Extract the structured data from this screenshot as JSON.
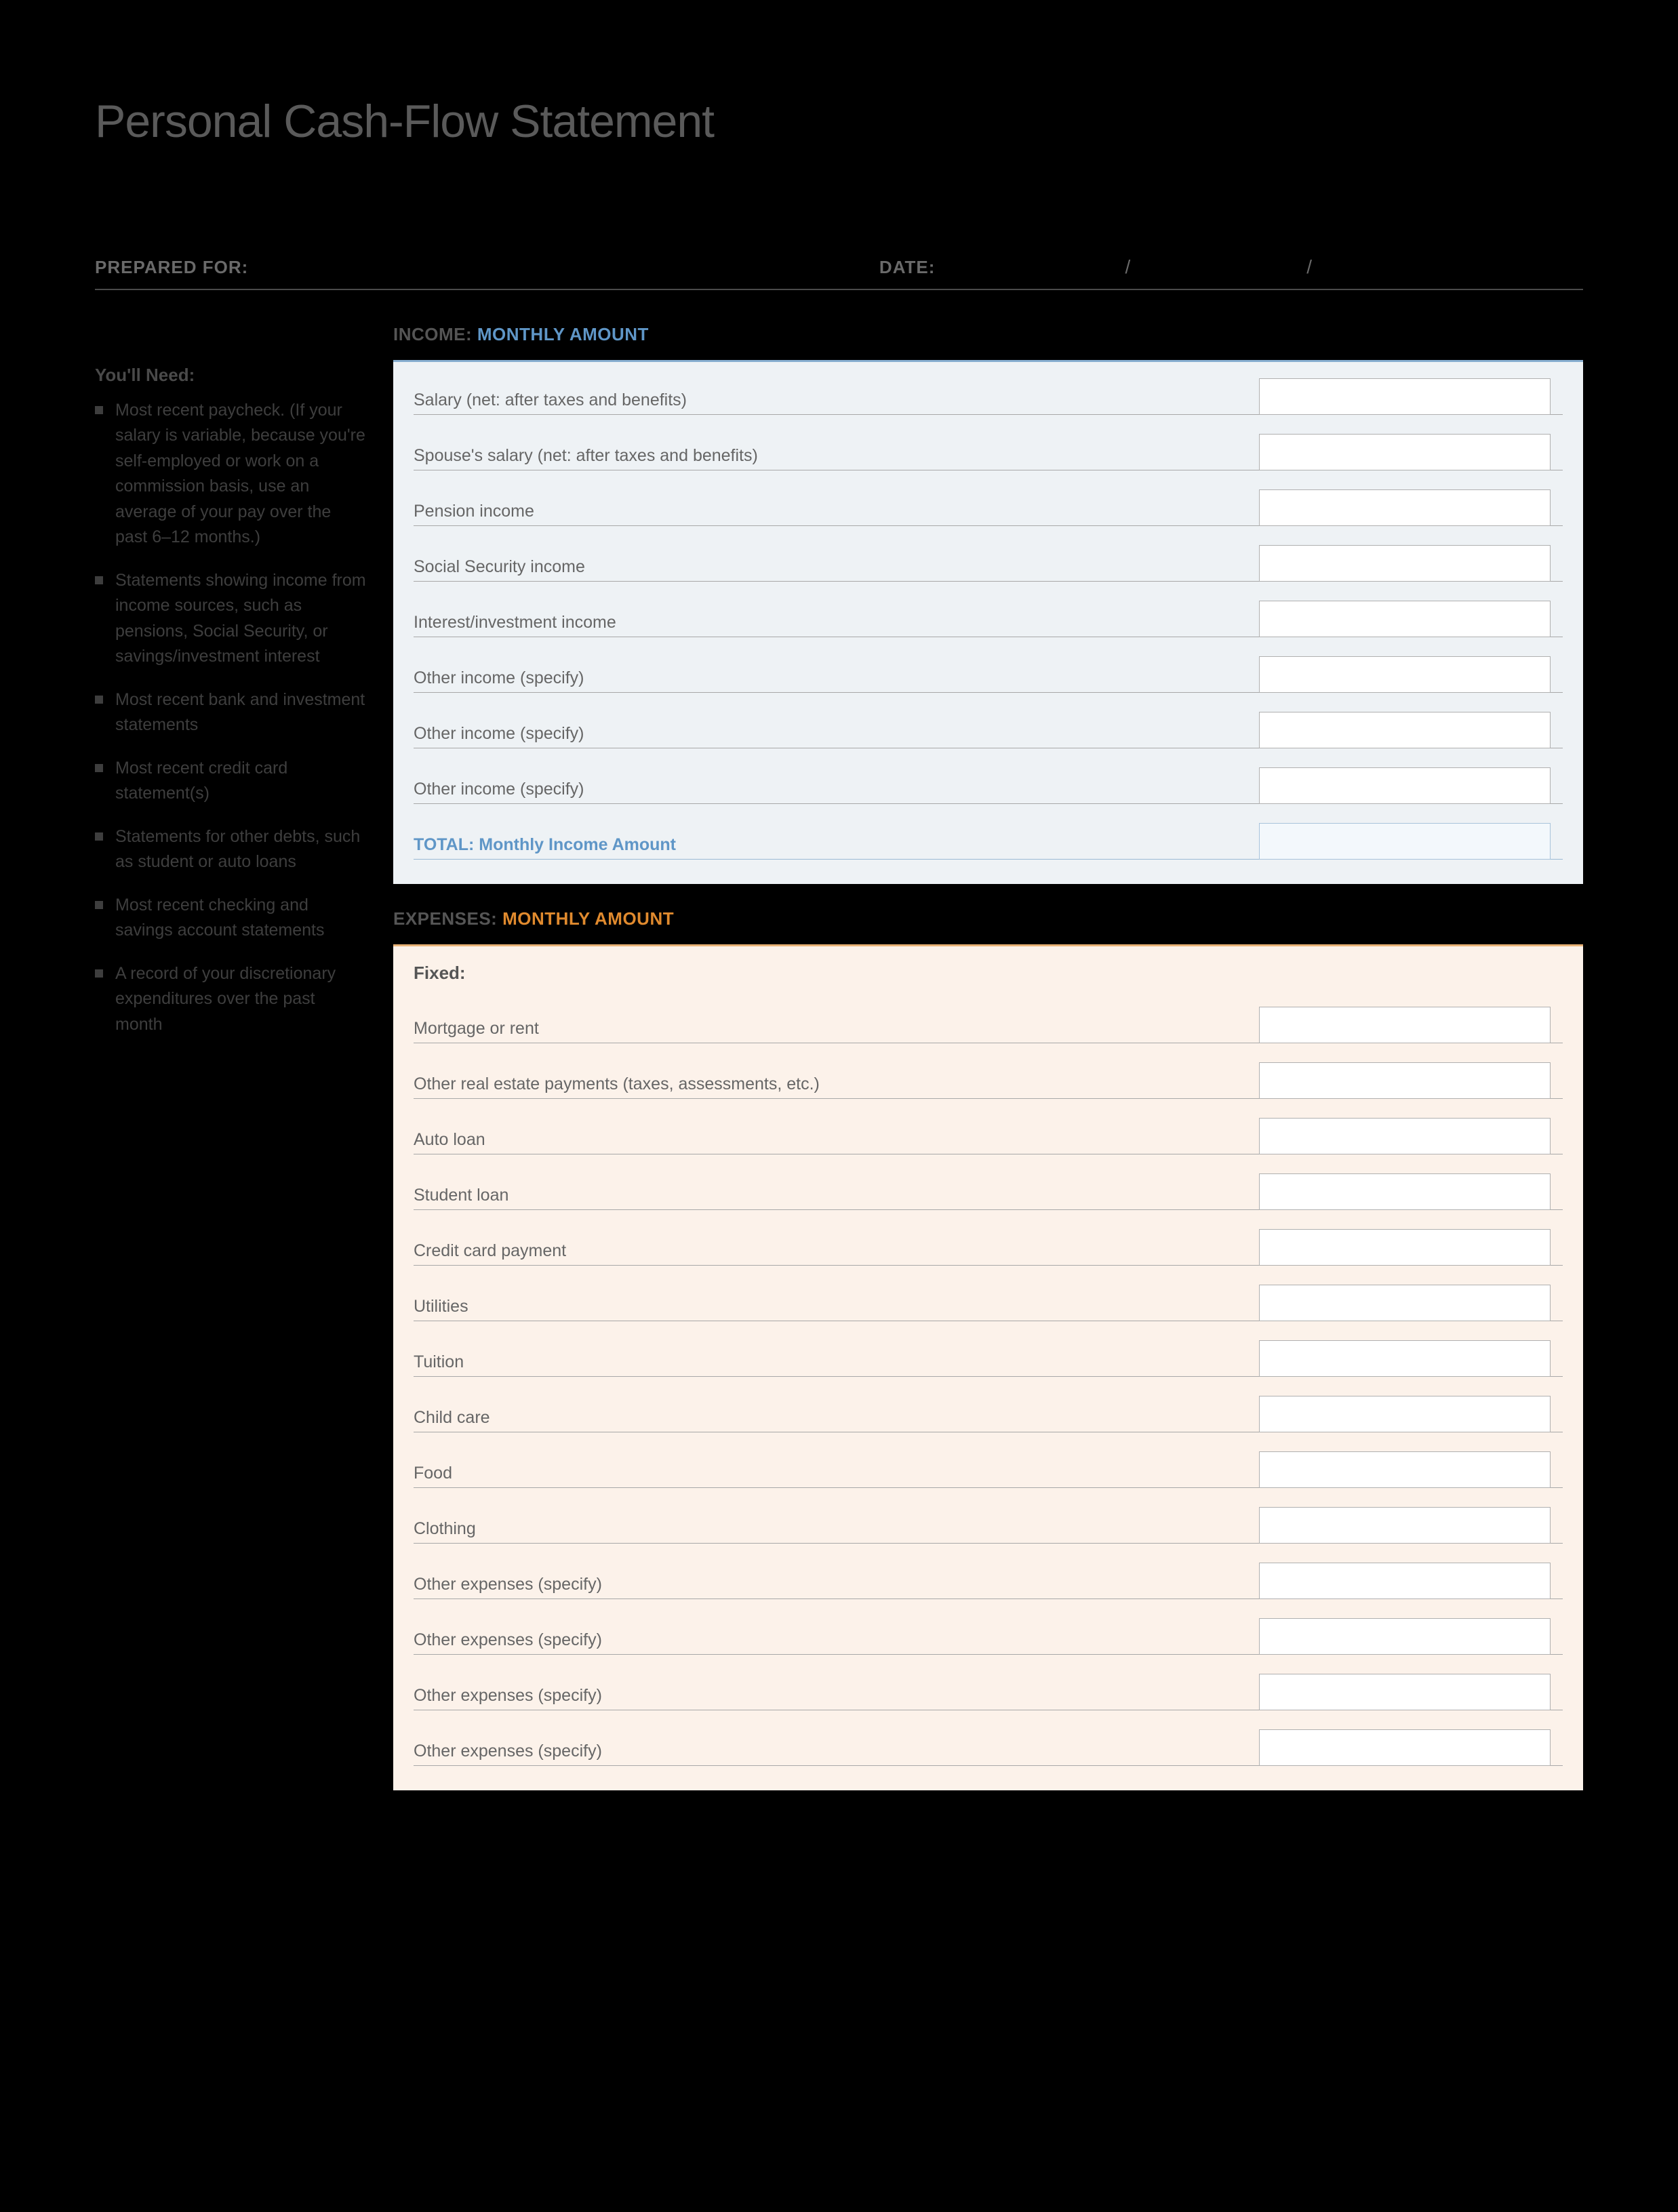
{
  "title": "Personal Cash-Flow Statement",
  "header": {
    "prepared_for_label": "PREPARED FOR:",
    "date_label": "DATE:",
    "date_sep": "/"
  },
  "sidebar": {
    "heading": "You'll Need:",
    "items": [
      "Most recent paycheck. (If your salary is variable, because you're self-employed or work on a commission basis, use an average of your pay over the past 6–12 months.)",
      "Statements showing income from income sources, such as pensions, Social Security, or savings/investment interest",
      "Most recent bank and investment statements",
      "Most recent credit card statement(s)",
      "Statements for other debts, such as student or auto loans",
      "Most recent checking and savings account statements",
      "A record of your discretionary expenditures over the past month"
    ]
  },
  "income": {
    "head_p1": "INCOME:  ",
    "head_p2": "MONTHLY AMOUNT",
    "rows": [
      "Salary (net: after taxes and benefits)",
      "Spouse's salary (net: after taxes and benefits)",
      "Pension income",
      "Social Security income",
      "Interest/investment income",
      "Other income (specify)",
      "Other income (specify)",
      "Other income (specify)"
    ],
    "total_label": "TOTAL: Monthly Income Amount"
  },
  "expenses": {
    "head_p1": "EXPENSES: ",
    "head_p2": "MONTHLY AMOUNT",
    "fixed_label": "Fixed:",
    "rows": [
      "Mortgage or rent",
      "Other real estate payments (taxes, assessments, etc.)",
      "Auto loan",
      "Student loan",
      "Credit card payment",
      "Utilities",
      "Tuition",
      "Child care",
      "Food",
      "Clothing",
      "Other expenses (specify)",
      "Other expenses (specify)",
      "Other expenses (specify)",
      "Other expenses (specify)"
    ]
  }
}
